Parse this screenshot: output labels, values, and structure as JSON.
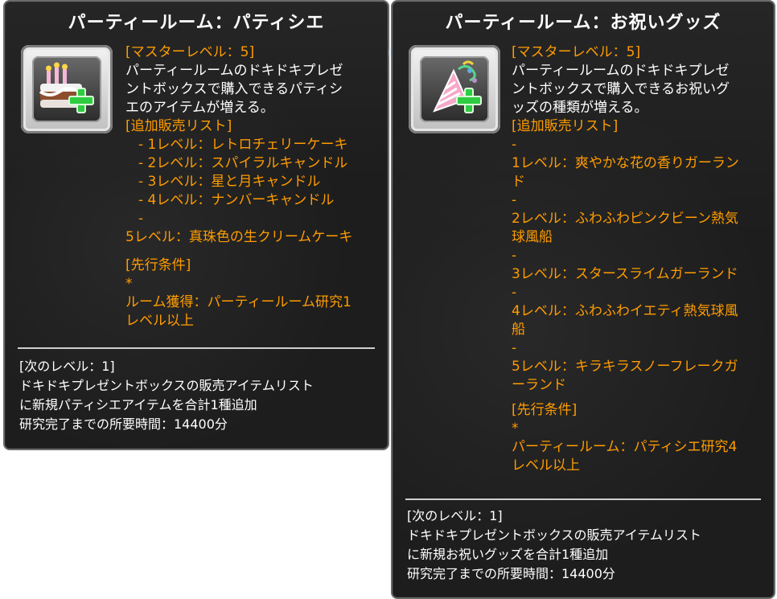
{
  "tooltips": [
    {
      "title": "パーティールーム：パティシエ",
      "master_level": "[マスターレベル：5]",
      "description_lines": [
        "パーティールームのドキドキプレゼ",
        "ントボックスで購入できるパティシ",
        "エのアイテムが増える。"
      ],
      "sales_list_label": "[追加販売リスト]",
      "sales_items": [
        "- 1レベル：レトロチェリーケーキ",
        "- 2レベル：スパイラルキャンドル",
        "- 3レベル：星と月キャンドル",
        "- 4レベル：ナンバーキャンドル",
        "-",
        "5レベル：真珠色の生クリームケーキ"
      ],
      "precondition_label": "[先行条件]",
      "precondition_lines": [
        "*",
        "ルーム獲得：パーティールーム研究1",
        "レベル以上"
      ],
      "next_level_label": "[次のレベル：1]",
      "next_level_lines": [
        "ドキドキプレゼントボックスの販売アイテムリスト",
        "に新規パティシエアイテムを合計1種追加",
        "研究完了までの所要時間：14400分"
      ],
      "icon": "birthday-cake-plus-icon"
    },
    {
      "title": "パーティールーム：お祝いグッズ",
      "master_level": "[マスターレベル：5]",
      "description_lines": [
        "パーティールームのドキドキプレゼ",
        "ントボックスで購入できるお祝いグ",
        "ッズの種類が増える。"
      ],
      "sales_list_label": "[追加販売リスト]",
      "sales_items": [
        "-",
        "1レベル：爽やかな花の香りガーラン",
        "ド",
        "-",
        "2レベル：ふわふわピンクビーン熱気",
        "球風船",
        "-",
        "3レベル：スタースライムガーランド",
        "-",
        "4レベル：ふわふわイエティ熱気球風",
        "船",
        "-",
        "5レベル：キラキラスノーフレークガ",
        "ーランド"
      ],
      "precondition_label": "[先行条件]",
      "precondition_lines": [
        "*",
        "パーティールーム：パティシエ研究4",
        "レベル以上"
      ],
      "next_level_label": "[次のレベル：1]",
      "next_level_lines": [
        "ドキドキプレゼントボックスの販売アイテムリスト",
        "に新規お祝いグッズを合計1種追加",
        "研究完了までの所要時間：14400分"
      ],
      "icon": "party-popper-plus-icon"
    }
  ],
  "colors": {
    "orange": "#ff9c00",
    "white": "#ffffff",
    "panel": "#141414",
    "border": "#6b6b6b"
  }
}
